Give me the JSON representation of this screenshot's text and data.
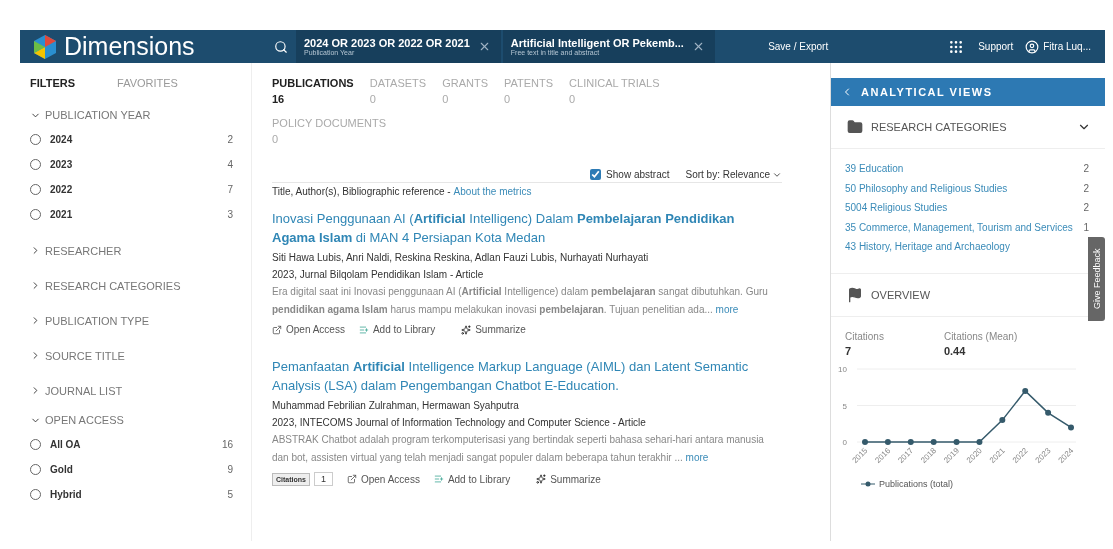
{
  "topbar": {
    "logo": "Dimensions",
    "search_chips": [
      {
        "value": "**2024** OR **2023** OR **2022** OR **2021**",
        "caption": "Publication Year"
      },
      {
        "value": "Artificial Intelligent OR Pekemb...",
        "caption": "Free text in title and abstract"
      }
    ],
    "save_export": "Save / Export",
    "support": "Support",
    "user": "Fitra Luq..."
  },
  "sidebar": {
    "tabs": [
      {
        "label": "FILTERS",
        "selected": true
      },
      {
        "label": "FAVORITES",
        "selected": false
      }
    ],
    "sections": [
      {
        "title": "PUBLICATION YEAR",
        "expanded": true,
        "options": [
          {
            "label": "2024",
            "count": "2",
            "selected": false
          },
          {
            "label": "2023",
            "count": "4",
            "selected": false
          },
          {
            "label": "2022",
            "count": "7",
            "selected": false
          },
          {
            "label": "2021",
            "count": "3",
            "selected": false
          }
        ]
      },
      {
        "title": "RESEARCHER",
        "expanded": false
      },
      {
        "title": "RESEARCH CATEGORIES",
        "expanded": false
      },
      {
        "title": "PUBLICATION TYPE",
        "expanded": false
      },
      {
        "title": "SOURCE TITLE",
        "expanded": false
      },
      {
        "title": "JOURNAL LIST",
        "expanded": false
      },
      {
        "title": "OPEN ACCESS",
        "expanded": true,
        "options": [
          {
            "label": "All OA",
            "count": "16",
            "selected": false
          },
          {
            "label": "Gold",
            "count": "9",
            "selected": false
          },
          {
            "label": "Hybrid",
            "count": "5",
            "selected": false
          }
        ]
      }
    ]
  },
  "results": {
    "tabs": [
      {
        "label": "PUBLICATIONS",
        "count": "16",
        "selected": true
      },
      {
        "label": "DATASETS",
        "count": "0",
        "selected": false
      },
      {
        "label": "GRANTS",
        "count": "0",
        "selected": false
      },
      {
        "label": "PATENTS",
        "count": "0",
        "selected": false
      },
      {
        "label": "CLINICAL TRIALS",
        "count": "0",
        "selected": false
      },
      {
        "label": "POLICY DOCUMENTS",
        "count": "0",
        "selected": false
      }
    ],
    "show_abstract": {
      "label": "Show abstract",
      "checked": true
    },
    "sort": {
      "label": "Sort by:",
      "value": "Relevance"
    },
    "columns_note": "Title, Author(s), Bibliographic reference -",
    "metrics_link": "About the metrics",
    "items": [
      {
        "title": "Inovasi Penggunaan AI (**Artificial** Intelligenc) Dalam **Pembelajaran Pendidikan Agama Islam** di MAN 4 Persiapan Kota Medan",
        "authors": "Siti Hawa Lubis, Anri Naldi, Reskina Reskina, Adlan Fauzi Lubis, Nurhayati Nurhayati",
        "source": "2023, Jurnal Bilqolam Pendidikan Islam - Article",
        "abstract": "Era digital saat ini Inovasi penggunaan AI (**Artificial** Intelligence) dalam **pembelajaran** sangat dibutuhkan. Guru **pendidikan agama Islam** harus mampu melakukan inovasi **pembelajaran**. Tujuan penelitian ada...",
        "more": "more",
        "actions": [
          "Open Access",
          "Add to Library",
          "Summarize"
        ]
      },
      {
        "title": "Pemanfaatan **Artificial** Intelligence Markup Language (AIML) dan Latent Semantic Analysis (LSA) dalam Pengembangan Chatbot E-Education.",
        "authors": "Muhammad Febrilian Zulrahman, Hermawan Syahputra",
        "source": "2023, INTECOMS Journal of Information Technology and Computer Science - Article",
        "abstract": "ABSTRAK  Chatbot adalah program terkomputerisasi yang bertindak seperti bahasa sehari-hari antara manusia dan bot, assisten virtual yang telah menjadi sangat populer dalam beberapa tahun terakhir ...",
        "more": "more",
        "citations": {
          "label": "Citations",
          "count": "1"
        },
        "actions": [
          "Open Access",
          "Add to Library",
          "Summarize"
        ]
      }
    ]
  },
  "analytics": {
    "title": "ANALYTICAL VIEWS",
    "research_categories": {
      "title": "RESEARCH CATEGORIES",
      "items": [
        {
          "label": "39 Education",
          "count": "2"
        },
        {
          "label": "50 Philosophy and Religious Studies",
          "count": "2"
        },
        {
          "label": "5004 Religious Studies",
          "count": "2"
        },
        {
          "label": "35 Commerce, Management, Tourism and Services",
          "count": "1"
        },
        {
          "label": "43 History, Heritage and Archaeology"
        }
      ]
    },
    "overview": {
      "title": "OVERVIEW",
      "stats": [
        {
          "label": "Citations",
          "value": "7"
        },
        {
          "label": "Citations (Mean)",
          "value": "0.44"
        }
      ],
      "chart_data": {
        "type": "line",
        "categories": [
          "2015",
          "2016",
          "2017",
          "2018",
          "2019",
          "2020",
          "2021",
          "2022",
          "2023",
          "2024"
        ],
        "series": [
          {
            "name": "Publications (total)",
            "color": "#355a6b",
            "marker": true,
            "values": [
              0,
              0,
              0,
              0,
              0,
              0,
              3,
              7,
              4,
              2
            ]
          }
        ],
        "ylim": [
          0,
          10
        ],
        "yticks": [
          0,
          5,
          10
        ]
      }
    }
  },
  "feedback": "Give Feedback"
}
